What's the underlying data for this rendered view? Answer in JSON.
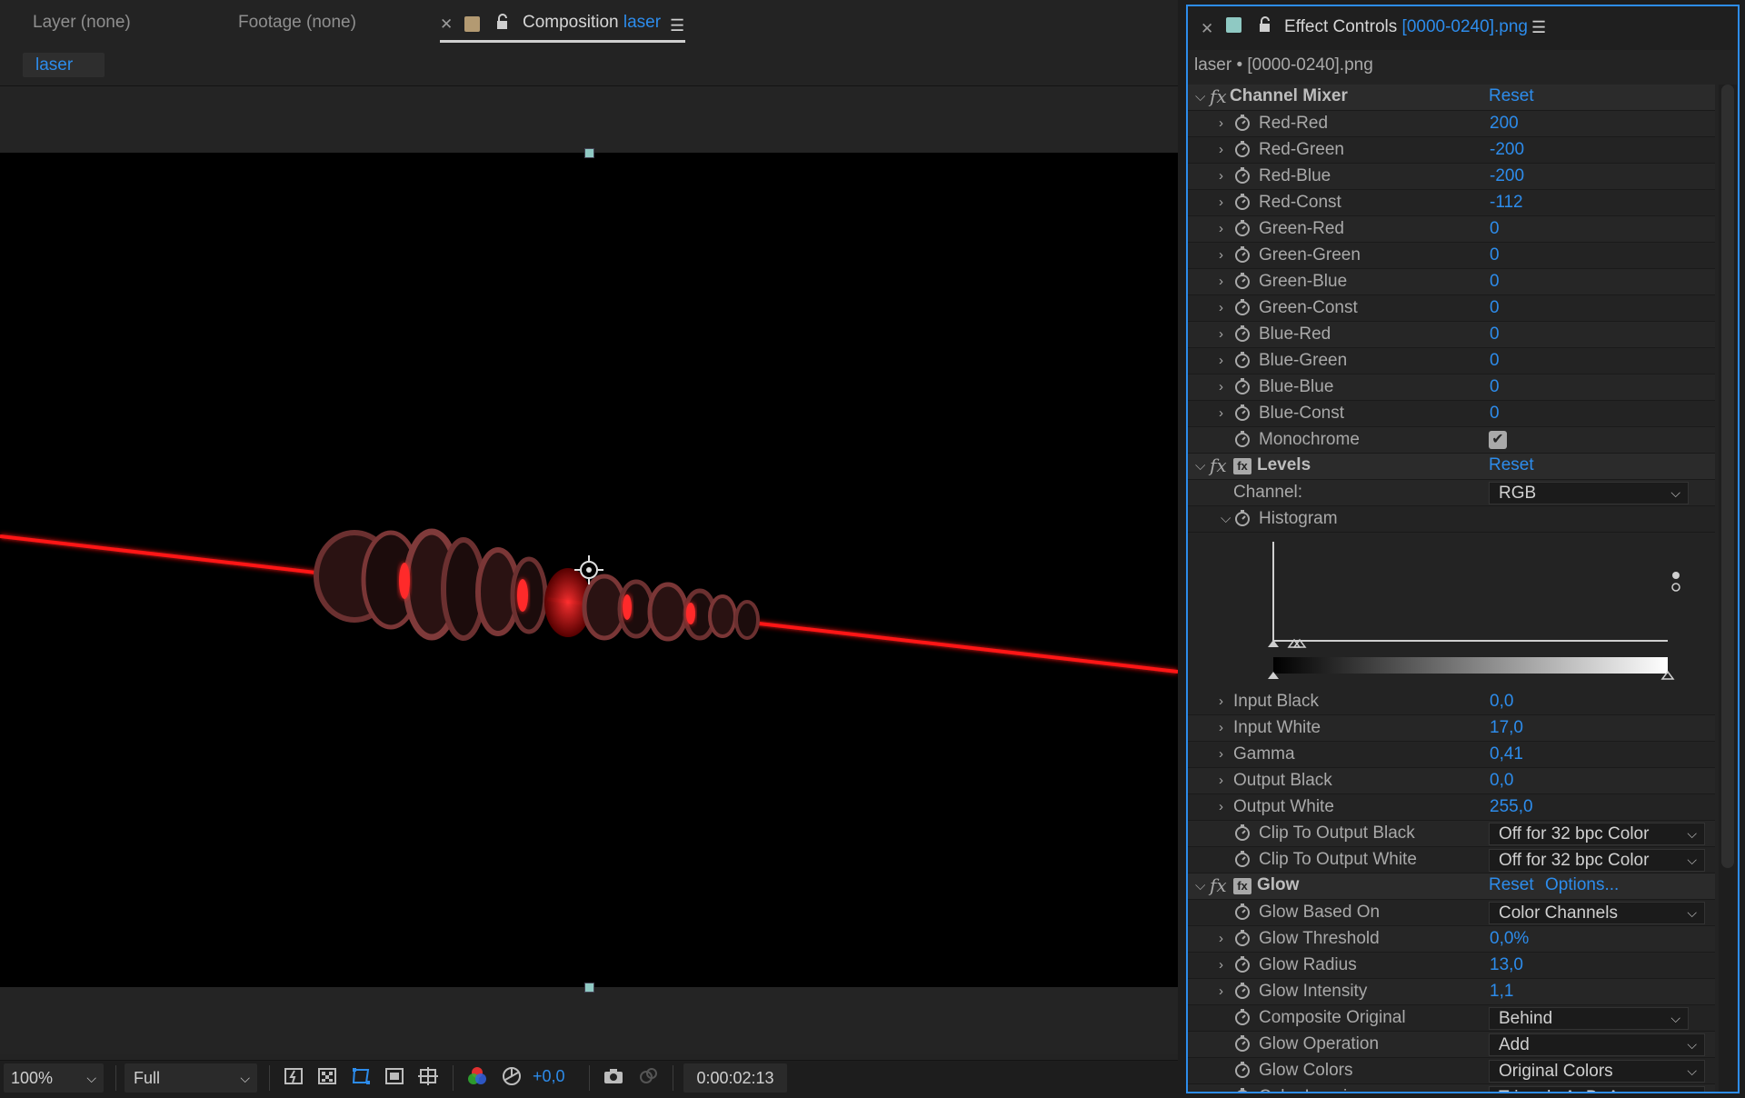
{
  "left_panel": {
    "tabs": {
      "layer": "Layer (none)",
      "footage": "Footage (none)",
      "composition_label": "Composition",
      "composition_name": "laser"
    },
    "comp_chip": "laser",
    "bottom": {
      "zoom": "100%",
      "resolution": "Full",
      "exposure": "+0,0",
      "timecode": "0:00:02:13"
    }
  },
  "right_panel": {
    "title_label": "Effect Controls",
    "title_file": "[0000-0240].png",
    "subtitle": "laser • [0000-0240].png",
    "channel_mixer": {
      "name": "Channel Mixer",
      "reset": "Reset",
      "params": [
        {
          "label": "Red-Red",
          "value": "200"
        },
        {
          "label": "Red-Green",
          "value": "-200"
        },
        {
          "label": "Red-Blue",
          "value": "-200"
        },
        {
          "label": "Red-Const",
          "value": "-112"
        },
        {
          "label": "Green-Red",
          "value": "0"
        },
        {
          "label": "Green-Green",
          "value": "0"
        },
        {
          "label": "Green-Blue",
          "value": "0"
        },
        {
          "label": "Green-Const",
          "value": "0"
        },
        {
          "label": "Blue-Red",
          "value": "0"
        },
        {
          "label": "Blue-Green",
          "value": "0"
        },
        {
          "label": "Blue-Blue",
          "value": "0"
        },
        {
          "label": "Blue-Const",
          "value": "0"
        }
      ],
      "monochrome_label": "Monochrome",
      "monochrome_checked": true
    },
    "levels": {
      "name": "Levels",
      "reset": "Reset",
      "channel_label": "Channel:",
      "channel_value": "RGB",
      "histogram_label": "Histogram",
      "params": [
        {
          "label": "Input Black",
          "value": "0,0"
        },
        {
          "label": "Input White",
          "value": "17,0"
        },
        {
          "label": "Gamma",
          "value": "0,41"
        },
        {
          "label": "Output Black",
          "value": "0,0"
        },
        {
          "label": "Output White",
          "value": "255,0"
        }
      ],
      "clip_black_label": "Clip To Output Black",
      "clip_black_value": "Off for 32 bpc Color",
      "clip_white_label": "Clip To Output White",
      "clip_white_value": "Off for 32 bpc Color"
    },
    "glow": {
      "name": "Glow",
      "reset": "Reset",
      "options": "Options...",
      "based_on_label": "Glow Based On",
      "based_on_value": "Color Channels",
      "threshold_label": "Glow Threshold",
      "threshold_value": "0,0%",
      "radius_label": "Glow Radius",
      "radius_value": "13,0",
      "intensity_label": "Glow Intensity",
      "intensity_value": "1,1",
      "composite_label": "Composite Original",
      "composite_value": "Behind",
      "operation_label": "Glow Operation",
      "operation_value": "Add",
      "colors_label": "Glow Colors",
      "colors_value": "Original Colors",
      "looping_label": "Color Looping",
      "looping_value": "Triangle A>B>A"
    }
  },
  "colors": {
    "accent": "#2d8ceb",
    "laser": "#ff1a1a",
    "panel_bg": "#232323"
  }
}
